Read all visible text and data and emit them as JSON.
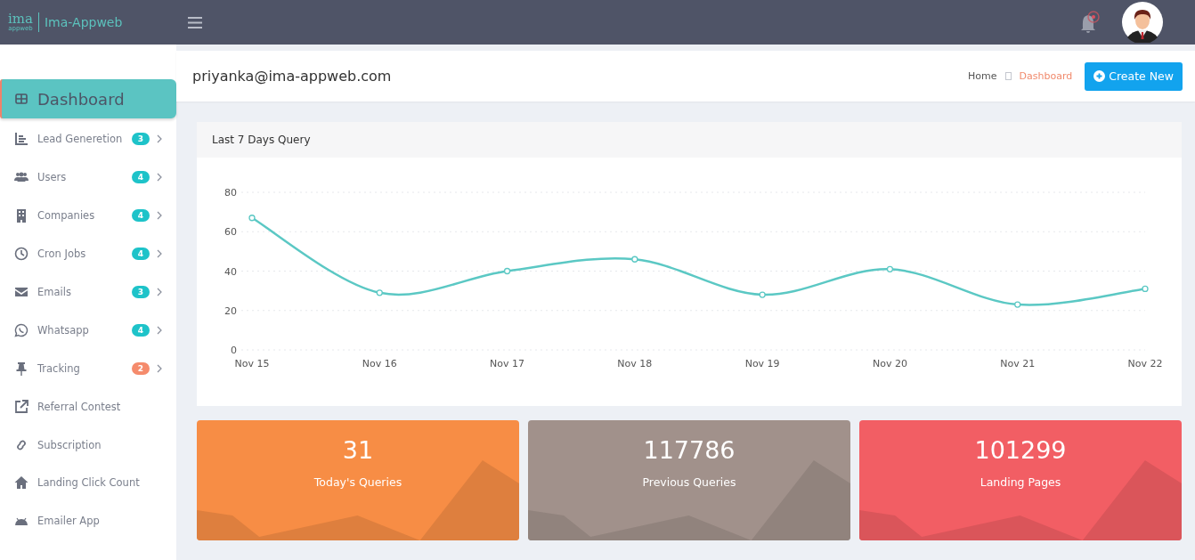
{
  "brand": {
    "logo": "ima",
    "logo_sub": "appweb",
    "name": "Ima-Appweb"
  },
  "sidebar": {
    "items": [
      {
        "label": "Dashboard",
        "selected": true
      },
      {
        "label": "Lead Generetion",
        "selected": false,
        "badge": {
          "text": "3",
          "color": "#1ec3c9"
        }
      },
      {
        "label": "Users",
        "selected": false,
        "badge": {
          "text": "4",
          "color": "#1ec3c9"
        }
      },
      {
        "label": "Companies",
        "selected": false,
        "badge": {
          "text": "4",
          "color": "#1ec3c9"
        }
      },
      {
        "label": "Cron Jobs",
        "selected": false,
        "badge": {
          "text": "4",
          "color": "#1ec3c9"
        }
      },
      {
        "label": "Emails",
        "selected": false,
        "badge": {
          "text": "3",
          "color": "#1ec3c9"
        }
      },
      {
        "label": "Whatsapp",
        "selected": false,
        "badge": {
          "text": "4",
          "color": "#1ec3c9"
        }
      },
      {
        "label": "Tracking",
        "selected": false,
        "badge": {
          "text": "2",
          "color": "#f58b6c"
        }
      },
      {
        "label": "Referral Contest",
        "selected": false
      },
      {
        "label": "Subscription",
        "selected": false
      },
      {
        "label": "Landing Click Count",
        "selected": false
      },
      {
        "label": "Emailer App",
        "selected": false
      }
    ]
  },
  "page_header": {
    "title": "priyanka@ima-appweb.com",
    "breadcrumb": [
      {
        "label": "Home",
        "selected": false
      },
      {
        "label": "Dashboard",
        "selected": true
      }
    ],
    "button": "Create New"
  },
  "chart_card": {
    "title": "Last 7 Days Query",
    "chart_data": {
      "type": "line",
      "categories": [
        "Nov 15",
        "Nov 16",
        "Nov 17",
        "Nov 18",
        "Nov 19",
        "Nov 20",
        "Nov 21",
        "Nov 22"
      ],
      "series": [
        {
          "color": "#5bc8c4",
          "marker": true,
          "values": [
            67,
            29,
            40,
            46,
            28,
            41,
            23,
            31
          ]
        }
      ],
      "ylim": [
        0,
        80
      ],
      "yticks": [
        0,
        20,
        40,
        60,
        80
      ],
      "grid": true
    }
  },
  "stats": [
    {
      "value": "31",
      "label": "Today's Queries",
      "color": "#f78d45"
    },
    {
      "value": "117786",
      "label": "Previous Queries",
      "color": "#a1918b"
    },
    {
      "value": "101299",
      "label": "Landing Pages",
      "color": "#f25e64"
    }
  ]
}
